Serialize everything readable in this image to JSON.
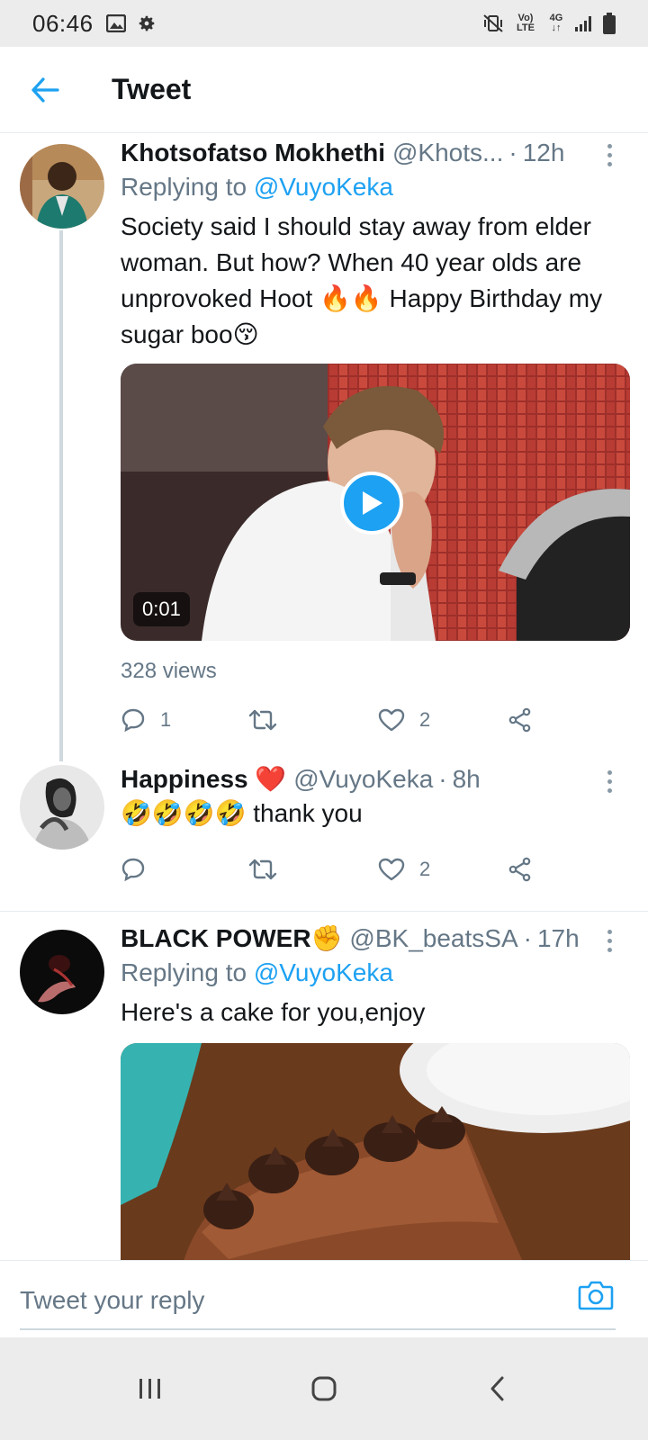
{
  "status_bar": {
    "time": "06:46",
    "left_icons": [
      "image-icon",
      "gear-icon"
    ],
    "right_icons": [
      "mute-vibrate-icon",
      "volte-icon",
      "network-4g-icon",
      "signal-icon",
      "battery-icon"
    ],
    "volte_label": "Vo) LTE",
    "network_label": "4G"
  },
  "app_bar": {
    "title": "Tweet",
    "back_icon": "arrow-left-icon"
  },
  "colors": {
    "accent": "#1da1f2",
    "text_primary": "#14171a",
    "text_secondary": "#657786",
    "border": "#e6ecf0",
    "system_bar": "#ececec"
  },
  "tweets": [
    {
      "name": "Khotsofatso Mokhethi",
      "handle": "@Khots...",
      "time": "12h",
      "replying_prefix": "Replying to",
      "replying_to": "@VuyoKeka",
      "text": "Society said I should stay away from elder woman. But how? When 40 year olds are unprovoked Hoot 🔥🔥 Happy Birthday my sugar boo😚",
      "media": {
        "type": "video",
        "duration": "0:01"
      },
      "views": "328 views",
      "actions": {
        "reply_count": "1",
        "retweet_count": "",
        "like_count": "2"
      }
    },
    {
      "name": "Happiness ❤️",
      "handle": "@VuyoKeka",
      "time": "8h",
      "text": "🤣🤣🤣🤣 thank you",
      "actions": {
        "reply_count": "",
        "retweet_count": "",
        "like_count": "2"
      }
    },
    {
      "name": "BLACK POWER✊",
      "handle": "@BK_beatsSA",
      "time": "17h",
      "replying_prefix": "Replying to",
      "replying_to": "@VuyoKeka",
      "text": "Here's a cake for you,enjoy",
      "media": {
        "type": "image"
      }
    }
  ],
  "composer": {
    "placeholder": "Tweet your reply",
    "camera_icon": "camera-icon"
  },
  "nav_bar": {
    "buttons": [
      "recent-apps-icon",
      "home-icon",
      "back-icon"
    ]
  }
}
